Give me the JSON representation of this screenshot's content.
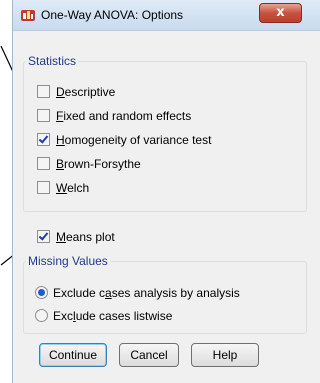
{
  "window": {
    "title": "One-Way ANOVA: Options",
    "close_glyph": "x"
  },
  "statistics": {
    "legend": "Statistics",
    "options": [
      {
        "pre": "",
        "ul": "D",
        "post": "escriptive",
        "checked": false
      },
      {
        "pre": "",
        "ul": "F",
        "post": "ixed and random effects",
        "checked": false
      },
      {
        "pre": "",
        "ul": "H",
        "post": "omogeneity of variance test",
        "checked": true
      },
      {
        "pre": "",
        "ul": "B",
        "post": "rown-Forsythe",
        "checked": false
      },
      {
        "pre": "",
        "ul": "W",
        "post": "elch",
        "checked": false
      }
    ]
  },
  "means_plot": {
    "pre": "",
    "ul": "M",
    "post": "eans plot",
    "checked": true
  },
  "missing_values": {
    "legend": "Missing Values",
    "options": [
      {
        "pre": "Exclude c",
        "ul": "a",
        "post": "ses analysis by analysis",
        "checked": true
      },
      {
        "pre": "Exc",
        "ul": "l",
        "post": "ude cases listwise",
        "checked": false
      }
    ]
  },
  "buttons": {
    "continue": "Continue",
    "cancel": "Cancel",
    "help": "Help"
  }
}
